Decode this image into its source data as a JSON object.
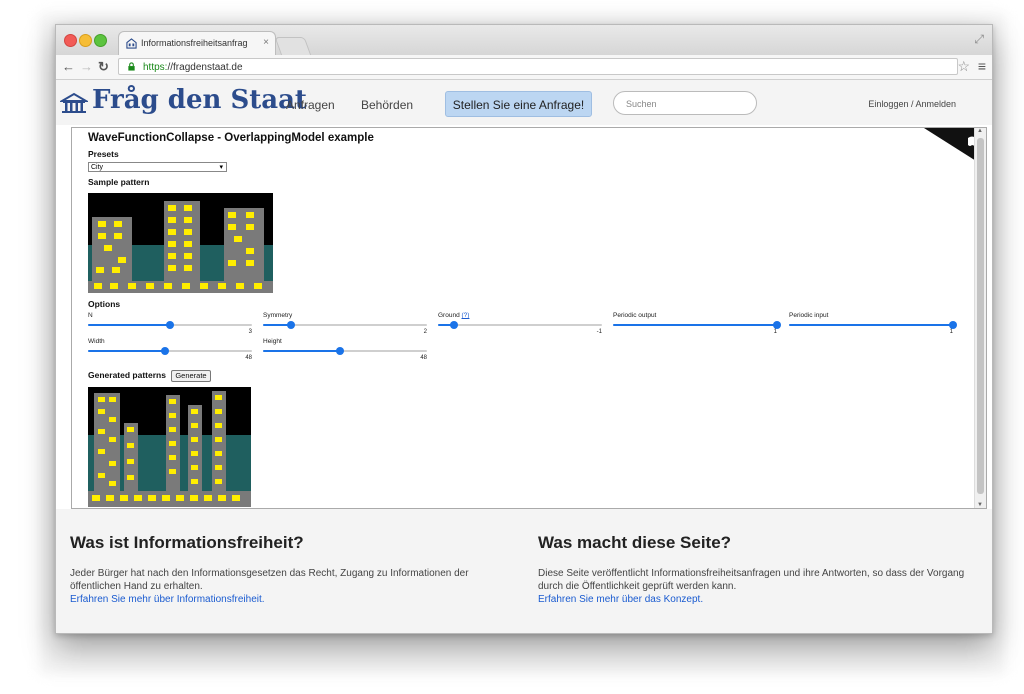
{
  "browser": {
    "tab_title": "Informationsfreiheitsanfrag",
    "tab_close": "×",
    "url_scheme": "https:",
    "url_rest": "//fragdenstaat.de"
  },
  "site": {
    "logo": "Fråg den Staat",
    "nav": [
      "Anfragen",
      "Behörden"
    ],
    "cta": "Stellen Sie eine Anfrage!",
    "search_placeholder": "Suchen",
    "login": "Einloggen / Anmelden"
  },
  "demo": {
    "title": "WaveFunctionCollapse - OverlappingModel example",
    "presets_label": "Presets",
    "preset_value": "City",
    "sample_label": "Sample pattern",
    "options_label": "Options",
    "options": [
      {
        "label": "N",
        "value": "3",
        "level": 0.5
      },
      {
        "label": "Symmetry",
        "value": "2",
        "level": 0.17
      },
      {
        "label": "Ground",
        "help": "(?)",
        "value": "-1",
        "level": 0.1
      },
      {
        "label": "Periodic output",
        "value": "1",
        "level": 1.0
      },
      {
        "label": "Periodic input",
        "value": "1",
        "level": 1.0
      },
      {
        "label": "Width",
        "value": "48",
        "level": 0.47
      },
      {
        "label": "Height",
        "value": "48",
        "level": 0.47
      }
    ],
    "generated_label": "Generated patterns",
    "generate_button": "Generate"
  },
  "footer": {
    "left": {
      "heading": "Was ist Informationsfreiheit?",
      "text": "Jeder Bürger hat nach den Informationsgesetzen das Recht, Zugang zu Informationen der öffentlichen Hand zu erhalten.",
      "link": "Erfahren Sie mehr über Informationsfreiheit."
    },
    "right": {
      "heading": "Was macht diese Seite?",
      "text": "Diese Seite veröffentlicht Informationsfreiheitsanfragen und ihre Antworten, so dass der Vorgang durch die Öffentlichkeit geprüft werden kann.",
      "link": "Erfahren Sie mehr über das Konzept."
    }
  },
  "colors": {
    "accent": "#1a73e8",
    "logo": "#2c4c8c",
    "cta_bg": "#bcd6f2",
    "pattern_bg": "#000000",
    "pattern_building": "#7a7a7a",
    "pattern_window": "#ffee00",
    "pattern_teal": "#1f5f5f"
  },
  "icons": {
    "logo": "building-icon",
    "lock": "lock-icon",
    "star": "bookmark-star-icon",
    "menu": "hamburger-menu-icon",
    "fork": "github-corner-icon"
  }
}
